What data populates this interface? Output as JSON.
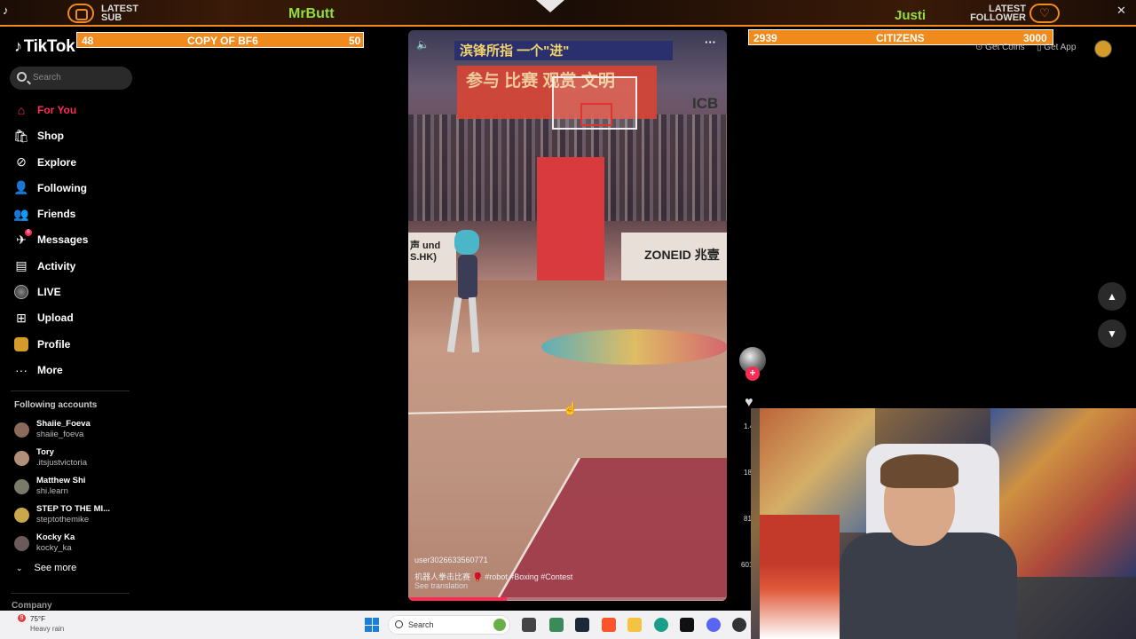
{
  "overlay": {
    "latest_sub_label": "LATEST SUB",
    "latest_sub_name": "MrButt",
    "latest_follower_label": "LATEST FOLLOWER",
    "latest_follower_name": "Justi",
    "close_glyph": "✕",
    "goal_left": {
      "current": "48",
      "title": "COPY OF BF6",
      "target": "50",
      "progress": 0.96
    },
    "goal_right": {
      "current": "2939",
      "title": "CITIZENS",
      "target": "3000",
      "progress": 0.98
    },
    "accent_color": "#f08a1c"
  },
  "tiktok": {
    "logo": "TikTok",
    "search_placeholder": "Search",
    "nav": [
      {
        "label": "For You",
        "icon": "home-icon",
        "active": true
      },
      {
        "label": "Shop",
        "icon": "shop-bag-icon"
      },
      {
        "label": "Explore",
        "icon": "compass-icon"
      },
      {
        "label": "Following",
        "icon": "following-person-icon"
      },
      {
        "label": "Friends",
        "icon": "friends-icon"
      },
      {
        "label": "Messages",
        "icon": "messages-icon",
        "badge": "6"
      },
      {
        "label": "Activity",
        "icon": "activity-icon"
      },
      {
        "label": "LIVE",
        "icon": "live-icon"
      },
      {
        "label": "Upload",
        "icon": "upload-icon"
      },
      {
        "label": "Profile",
        "icon": "profile-icon"
      },
      {
        "label": "More",
        "icon": "more-dots-icon"
      }
    ],
    "following_title": "Following accounts",
    "following": [
      {
        "name": "Shaiie_Foeva",
        "handle": "shaiie_foeva"
      },
      {
        "name": "Tory",
        "handle": ".itsjustvictoria"
      },
      {
        "name": "Matthew Shi",
        "handle": "shi.learn"
      },
      {
        "name": "STEP TO THE MI...",
        "handle": "steptothemike"
      },
      {
        "name": "Kocky Ka",
        "handle": "kocky_ka"
      }
    ],
    "see_more": "See more",
    "company": "Company",
    "top_links": {
      "get_coins": "Get Coins",
      "get_app": "Get App"
    },
    "brand_color": "#fe2c55"
  },
  "video": {
    "banner_text": "滨锋所指 一个\"进\"",
    "sign_text": "参与 比赛 观赏 文明",
    "icb_text": "ICB",
    "zoneid_text": "ZONEID 兆壹",
    "ad_left_text": "声 und S.HK)",
    "username": "user3026633560771",
    "caption": "机器人拳击比赛 🥊 #robot #Boxing #Contest",
    "see_translation": "See translation",
    "progress": 0.31
  },
  "rail": {
    "likes": "1.4",
    "comments": "18",
    "saves": "81",
    "shares": "601"
  },
  "taskbar": {
    "weather_badge": "9",
    "temperature": "75°F",
    "condition": "Heavy rain",
    "search_placeholder": "Search"
  }
}
